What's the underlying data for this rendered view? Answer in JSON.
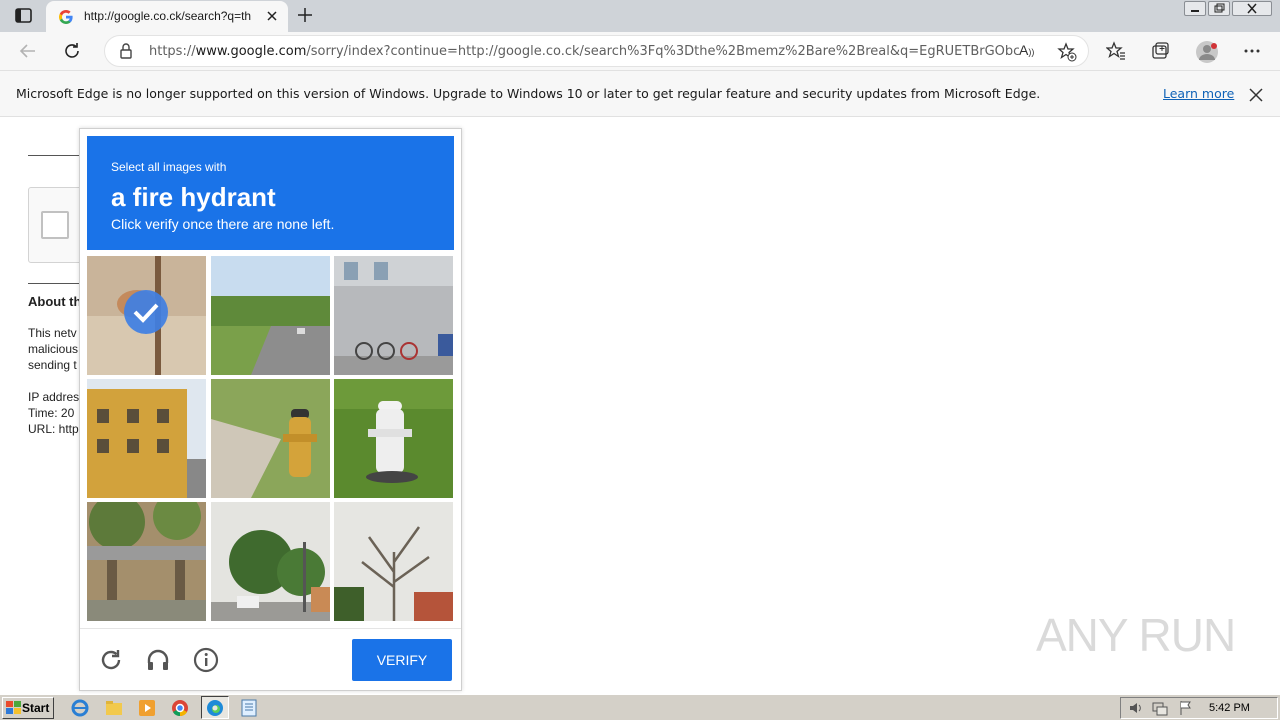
{
  "browser": {
    "tab_title": "http://google.co.ck/search?q=th",
    "url_prefix": "https://",
    "url_domain": "www.google.com",
    "url_rest": "/sorry/index?continue=http://google.co.ck/search%3Fq%3Dthe%2Bmemz%2Bare%2Breal&q=EgRUETBrGObcla0GIj...",
    "read_aloud_label": "A"
  },
  "infobar": {
    "message": "Microsoft Edge is no longer supported on this version of Windows. Upgrade to Windows 10 or later to get regular feature and security updates from Microsoft Edge.",
    "link": "Learn more"
  },
  "page": {
    "about_heading": "About th",
    "para_lines": [
      "This netv",
      "malicious",
      "sending t"
    ],
    "ip_line": "IP addres",
    "time_line": "Time: 20",
    "url_line": "URL: http"
  },
  "captcha": {
    "instruction_small": "Select all images with",
    "target": "a fire hydrant",
    "instruction_sub": "Click verify once there are none left.",
    "verify_label": "VERIFY",
    "tiles": [
      {
        "content": "hydrant top closeup",
        "selected": true
      },
      {
        "content": "road with trees",
        "selected": false
      },
      {
        "content": "bicycles by building",
        "selected": false
      },
      {
        "content": "yellow building",
        "selected": false
      },
      {
        "content": "yellow fire hydrant",
        "selected": false
      },
      {
        "content": "white fire hydrant",
        "selected": false
      },
      {
        "content": "bench under tree",
        "selected": false
      },
      {
        "content": "street with trees",
        "selected": false
      },
      {
        "content": "bare tree",
        "selected": false
      }
    ]
  },
  "taskbar": {
    "start_label": "Start",
    "clock": "5:42 PM"
  },
  "watermark": "ANY RUN",
  "colors": {
    "accent": "#1a73e8",
    "link": "#0f62b7"
  }
}
